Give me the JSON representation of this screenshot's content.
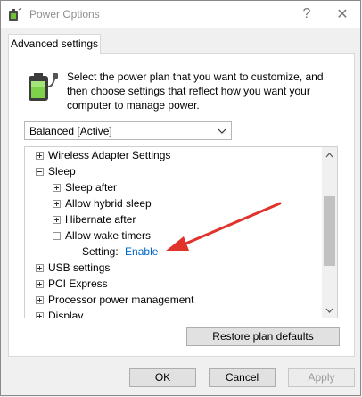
{
  "window": {
    "title": "Power Options",
    "help_glyph": "?",
    "close_glyph": "✕"
  },
  "tab": {
    "label": "Advanced settings"
  },
  "description": "Select the power plan that you want to customize, and then choose settings that reflect how you want your computer to manage power.",
  "plan_select": {
    "value": "Balanced [Active]"
  },
  "tree": {
    "items": [
      {
        "label": "Wireless Adapter Settings",
        "expanded": false
      },
      {
        "label": "Sleep",
        "expanded": true
      },
      {
        "label": "Sleep after",
        "expanded": false
      },
      {
        "label": "Allow hybrid sleep",
        "expanded": false
      },
      {
        "label": "Hibernate after",
        "expanded": false
      },
      {
        "label": "Allow wake timers",
        "expanded": true
      },
      {
        "label": "USB settings",
        "expanded": false
      },
      {
        "label": "PCI Express",
        "expanded": false
      },
      {
        "label": "Processor power management",
        "expanded": false
      },
      {
        "label": "Display",
        "expanded": false
      }
    ],
    "setting": {
      "label": "Setting:",
      "value": "Enable"
    }
  },
  "buttons": {
    "restore": "Restore plan defaults",
    "ok": "OK",
    "cancel": "Cancel",
    "apply": "Apply"
  },
  "colors": {
    "link": "#0066cc",
    "annotation_arrow": "#e0332b"
  },
  "icons": {
    "title": "power-options-icon",
    "battery": "battery-plug-icon"
  }
}
